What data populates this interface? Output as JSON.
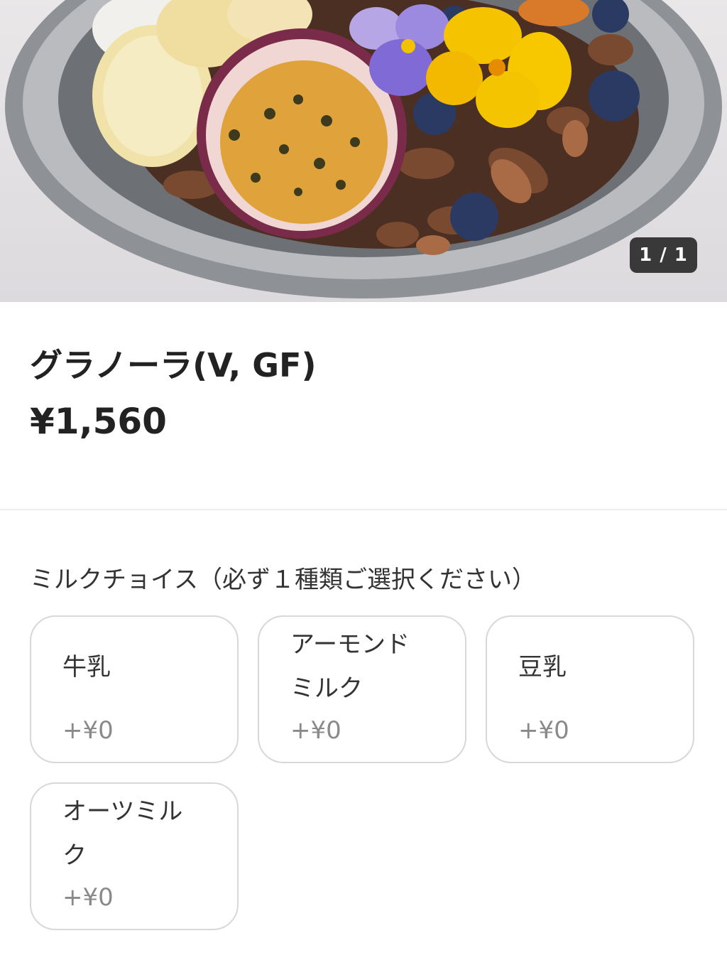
{
  "gallery": {
    "counter": "1 / 1",
    "photo_subject": "granola bowl"
  },
  "product": {
    "title": "グラノーラ(V, GF)",
    "price": "¥1,560"
  },
  "options_section": {
    "title": "ミルクチョイス（必ず１種類ご選択ください）",
    "items": [
      {
        "label": "牛乳",
        "price": "+¥0"
      },
      {
        "label": "アーモンドミルク",
        "price": "+¥0"
      },
      {
        "label": "豆乳",
        "price": "+¥0"
      },
      {
        "label": "オーツミルク",
        "price": "+¥0"
      }
    ]
  },
  "colors": {
    "text_primary": "#222222",
    "text_secondary": "#8a8a8a",
    "border": "#d8d8d8",
    "counter_bg": "#1c1c1c"
  }
}
